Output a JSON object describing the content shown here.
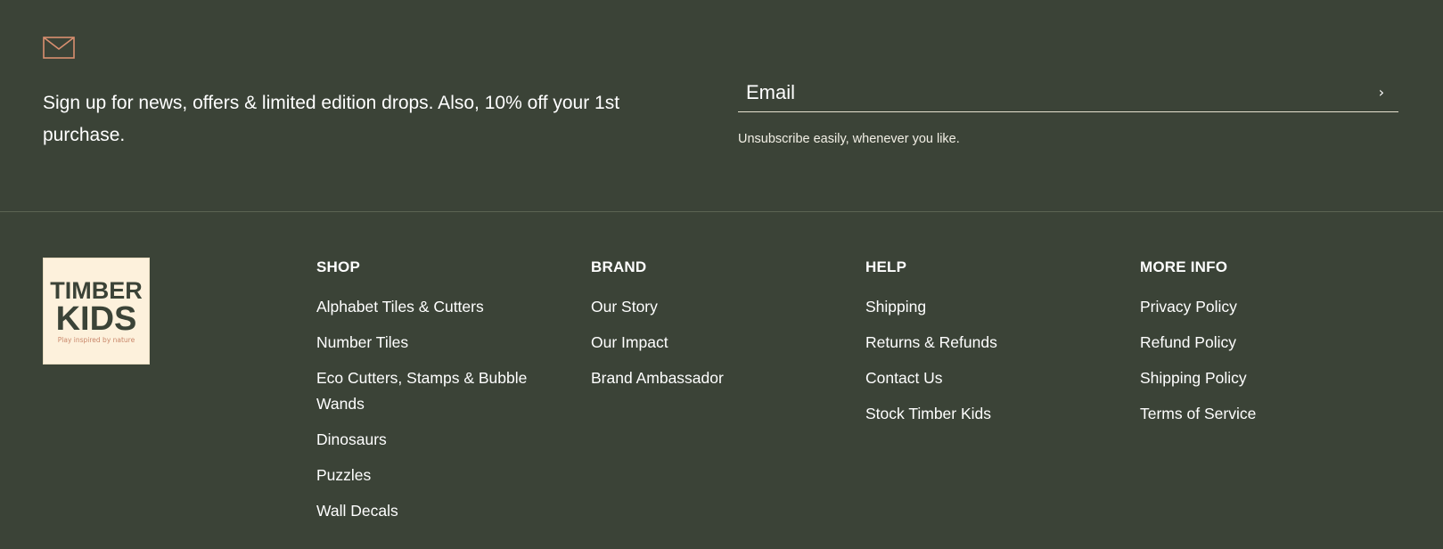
{
  "newsletter": {
    "icon": "mail-icon",
    "icon_color": "#d98f70",
    "text": "Sign up for news, offers & limited edition drops. Also, 10% off your 1st purchase.",
    "email_placeholder": "Email",
    "submit_icon": "chevron-right-icon",
    "submit_glyph": "›",
    "note": "Unsubscribe easily, whenever you like."
  },
  "logo": {
    "line1": "TIMBER",
    "line2": "KIDS",
    "tagline": "Play inspired by nature"
  },
  "columns": [
    {
      "title": "SHOP",
      "links": [
        "Alphabet Tiles & Cutters",
        "Number Tiles",
        "Eco Cutters, Stamps & Bubble Wands",
        "Dinosaurs",
        "Puzzles",
        "Wall Decals"
      ]
    },
    {
      "title": "BRAND",
      "links": [
        "Our Story",
        "Our Impact",
        "Brand Ambassador"
      ]
    },
    {
      "title": "HELP",
      "links": [
        "Shipping",
        "Returns & Refunds",
        "Contact Us",
        "Stock Timber Kids"
      ]
    },
    {
      "title": "MORE INFO",
      "links": [
        "Privacy Policy",
        "Refund Policy",
        "Shipping Policy",
        "Terms of Service"
      ]
    }
  ],
  "colors": {
    "background": "#3b4337",
    "logo_background": "#fdf1dc",
    "logo_text": "#3b4337",
    "tagline": "#c9876a"
  }
}
